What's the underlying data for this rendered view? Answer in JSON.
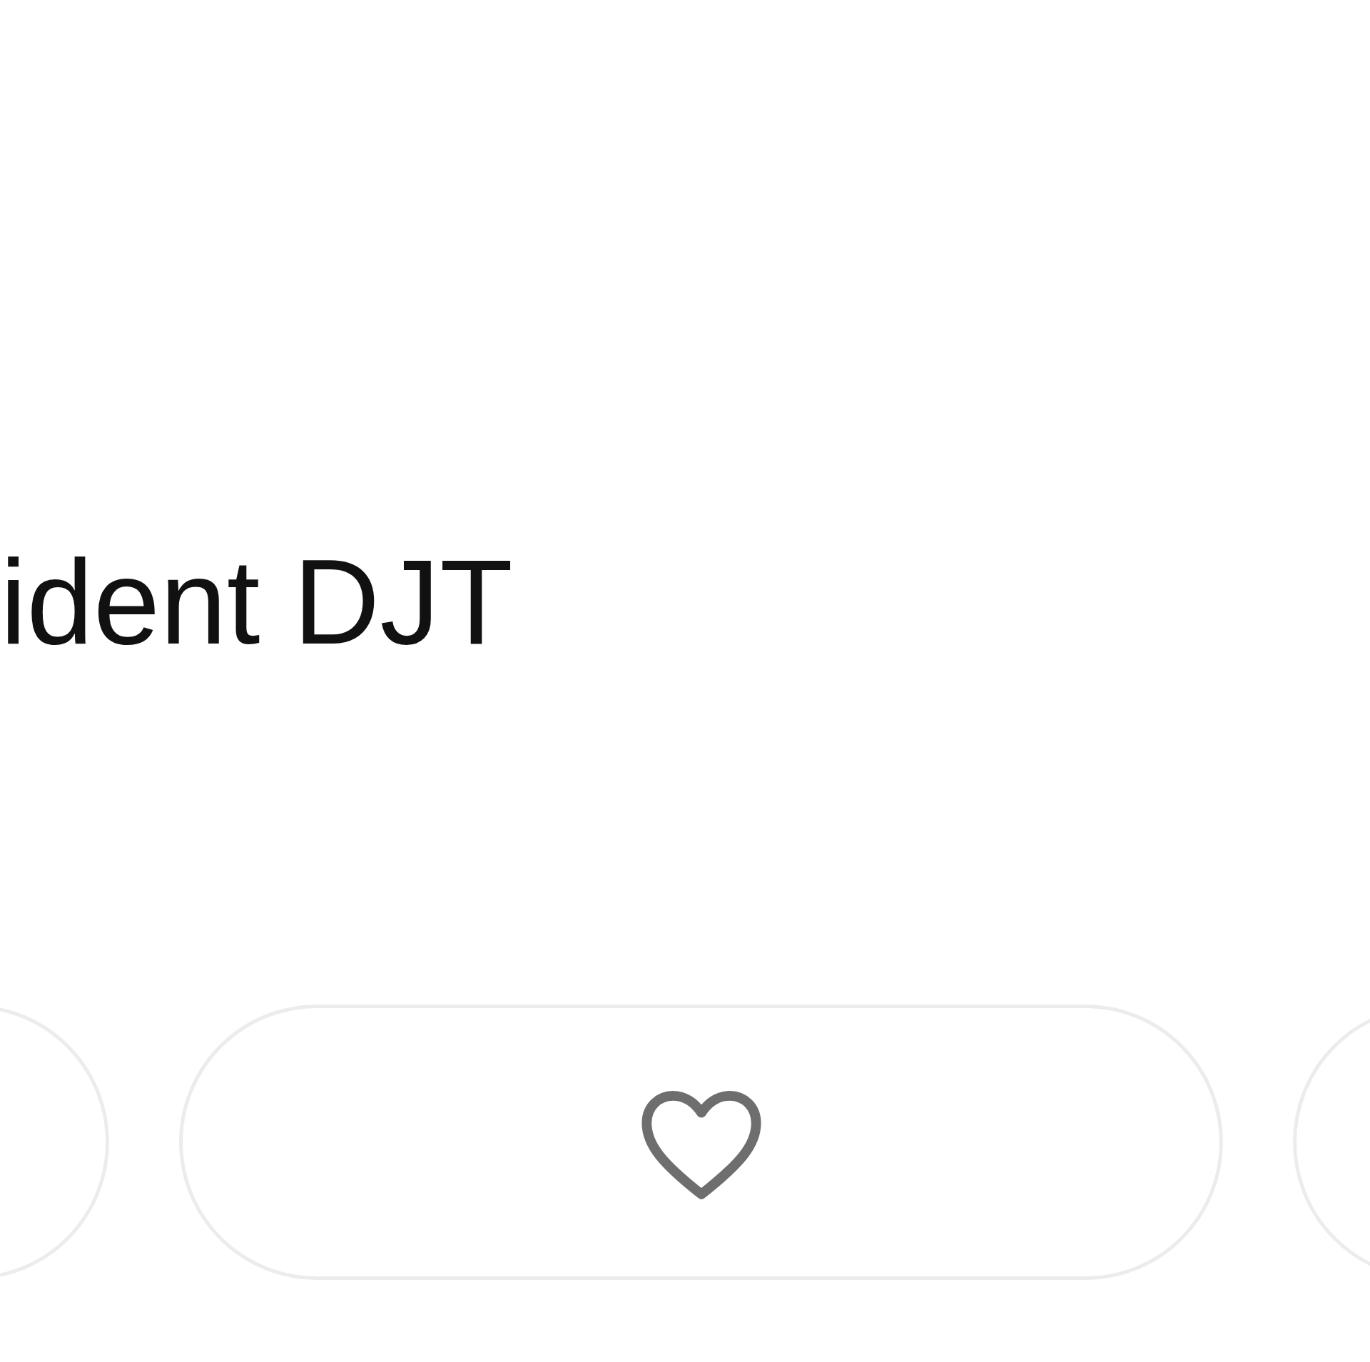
{
  "post": {
    "text": "ident DJT"
  },
  "actions": [
    {
      "kind": "partial"
    },
    {
      "kind": "like",
      "liked": false
    },
    {
      "kind": "partial"
    }
  ]
}
